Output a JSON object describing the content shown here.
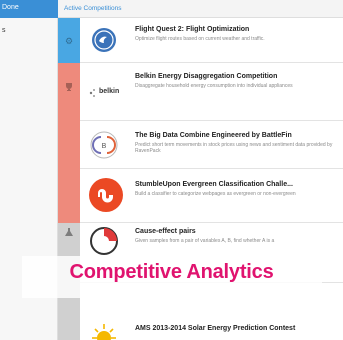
{
  "sidebar": {
    "header_label": "Done",
    "item_label": "s"
  },
  "header": {
    "title": "Active Competitions"
  },
  "competitions": [
    {
      "logo": "ge-logo",
      "title": "Flight Quest 2: Flight Optimization",
      "description": "Optimize flight routes based on current weather and traffic."
    },
    {
      "logo": "belkin-logo",
      "logo_text": "belkin",
      "title": "Belkin Energy Disaggregation Competition",
      "description": "Disaggregate household energy consumption into individual appliances"
    },
    {
      "logo": "battlefin-logo",
      "title": "The Big Data Combine Engineered by BattleFin",
      "description": "Predict short term movements in stock prices using news and sentiment data provided by RavenPack"
    },
    {
      "logo": "stumbleupon-logo",
      "title": "StumbleUpon Evergreen Classification Challe...",
      "description": "Build a classifier to categorize webpages as evergreen or non-evergreen"
    },
    {
      "logo": "cause-effect-logo",
      "title": "Cause-effect pairs",
      "description": "Given samples from a pair of variables A, B, find whether A is a"
    },
    {
      "logo": "ams-logo",
      "title": "AMS 2013-2014 Solar Energy Prediction Contest",
      "description": ""
    }
  ],
  "overlay": {
    "text": "Competitive Analytics"
  },
  "colors": {
    "header_blue": "#3a8fd6",
    "stripe_blue": "#49a7e3",
    "stripe_red": "#ee8a7c",
    "stripe_gray": "#d0d0d0",
    "overlay_pink": "#e0136f",
    "stumbleupon_orange": "#eb4924"
  },
  "stripe_icons": [
    "gear-icon",
    "trophy-icon",
    "flask-icon"
  ]
}
